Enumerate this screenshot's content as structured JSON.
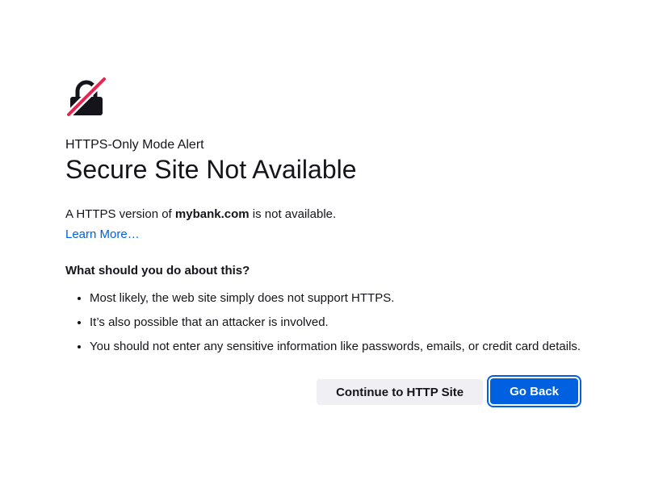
{
  "alert": {
    "eyebrow": "HTTPS-Only Mode Alert",
    "title": "Secure Site Not Available",
    "icon": "insecure-lock-icon",
    "description": {
      "prefix": "A HTTPS version of ",
      "domain": "mybank.com",
      "suffix": " is not available."
    },
    "learn_more": "Learn More…",
    "question": "What should you do about this?",
    "advice": [
      "Most likely, the web site simply does not support HTTPS.",
      "It’s also possible that an attacker is involved.",
      "You should not enter any sensitive information like passwords, emails, or credit card details."
    ]
  },
  "buttons": {
    "continue_label": "Continue to HTTP Site",
    "go_back_label": "Go Back"
  },
  "colors": {
    "accent": "#0061e0",
    "icon_slash": "#e22850",
    "text": "#15141a",
    "secondary_button": "#f0f0f4"
  }
}
